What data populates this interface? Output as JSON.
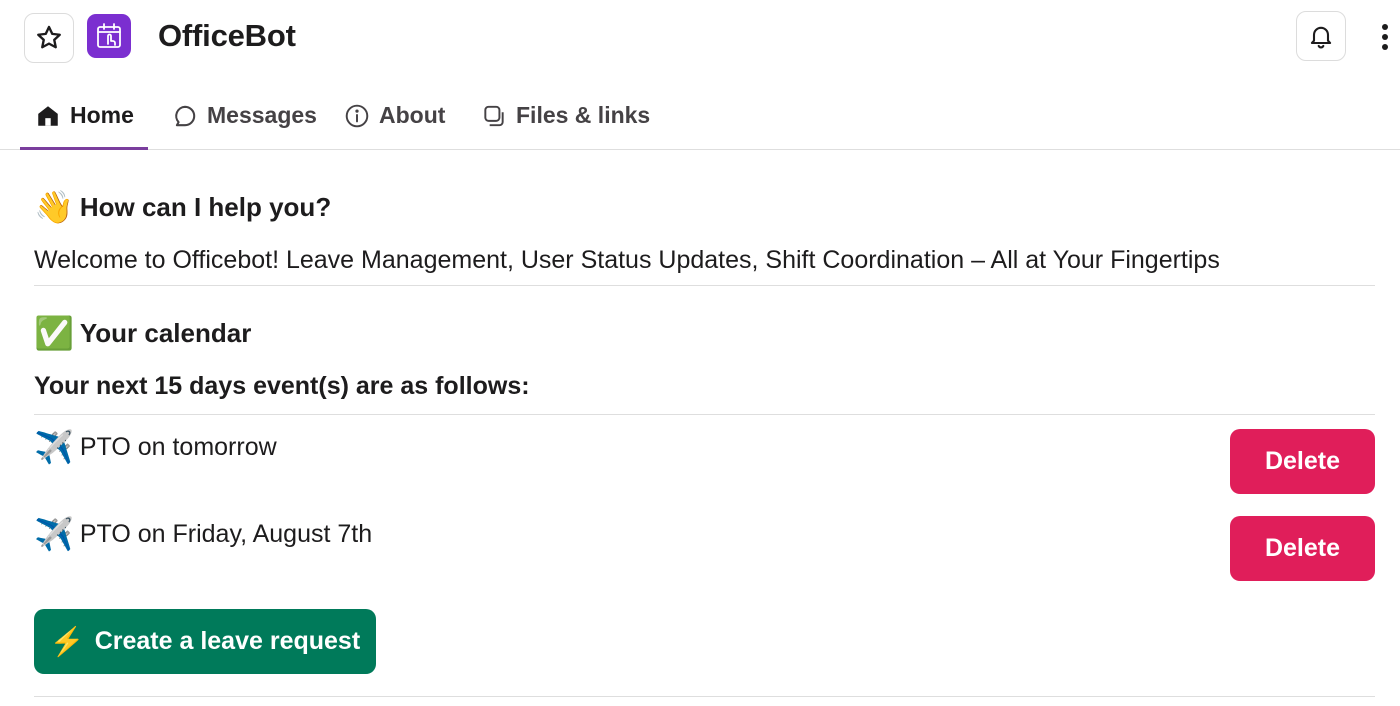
{
  "header": {
    "app_name": "OfficeBot",
    "star_icon": "star-icon",
    "app_icon": "officebot-calendar-icon",
    "bell_icon": "bell-icon",
    "more_icon": "more-vertical-icon"
  },
  "tabs": [
    {
      "label": "Home",
      "icon": "home-icon",
      "active": true
    },
    {
      "label": "Messages",
      "icon": "message-icon",
      "active": false
    },
    {
      "label": "About",
      "icon": "info-icon",
      "active": false
    },
    {
      "label": "Files & links",
      "icon": "files-icon",
      "active": false
    }
  ],
  "help": {
    "emoji": "👋",
    "title": "How can I help you?",
    "welcome": "Welcome to Officebot! Leave Management, User Status Updates, Shift Coordination – All at Your Fingertips"
  },
  "calendar": {
    "emoji": "✅",
    "title": "Your calendar",
    "subtitle": "Your next 15 days event(s) are as follows:",
    "events": [
      {
        "emoji": "✈️",
        "text": "PTO on tomorrow",
        "action": "Delete"
      },
      {
        "emoji": "✈️",
        "text": "PTO on Friday, August 7th",
        "action": "Delete"
      }
    ],
    "create_emoji": "⚡",
    "create_label": "Create a leave request"
  },
  "colors": {
    "accent": "#7a3e9d",
    "app_icon_bg": "#7b2fd0",
    "delete": "#e01e5a",
    "create": "#007a5a"
  }
}
